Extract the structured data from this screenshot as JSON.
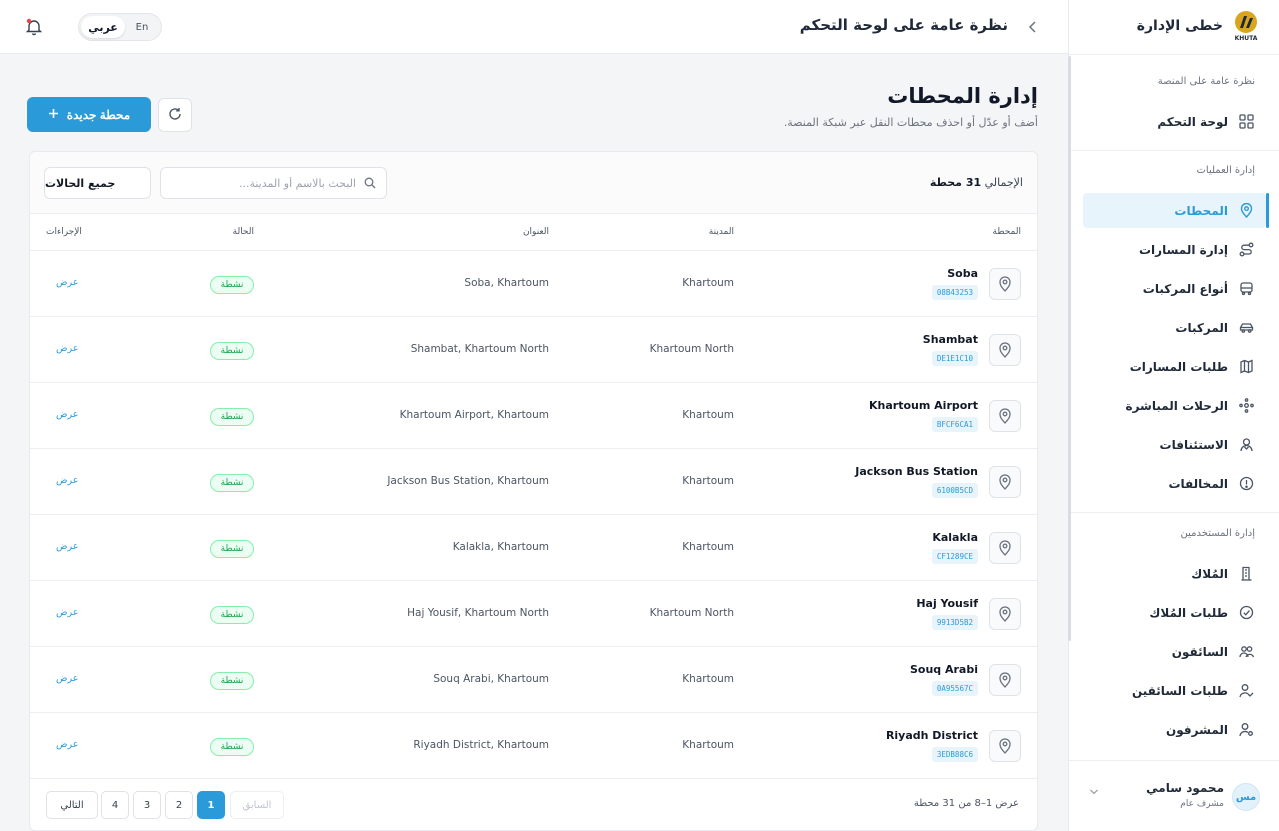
{
  "topbar": {
    "title": "نظرة عامة على لوحة التحكم",
    "lang_active": "عربي",
    "lang_other": "En"
  },
  "brand": {
    "name": "خطى الإدارة",
    "logo_text": "KHUTA"
  },
  "sidebar": {
    "sections": [
      {
        "title": "نظرة عامة على المنصة"
      },
      {
        "title": "إدارة العمليات"
      },
      {
        "title": "إدارة المستخدمين"
      }
    ],
    "items": [
      {
        "label": "لوحة التحكم",
        "icon": "grid-icon",
        "active": false
      },
      {
        "label": "المحطات",
        "icon": "location-pin-icon",
        "active": true
      },
      {
        "label": "إدارة المسارات",
        "icon": "route-icon",
        "active": false
      },
      {
        "label": "أنواع المركبات",
        "icon": "bus-icon",
        "active": false
      },
      {
        "label": "المركبات",
        "icon": "car-icon",
        "active": false
      },
      {
        "label": "طلبات المسارات",
        "icon": "map-request-icon",
        "active": false
      },
      {
        "label": "الرحلات المباشرة",
        "icon": "live-trip-icon",
        "active": false
      },
      {
        "label": "الاستئنافات",
        "icon": "appeal-icon",
        "active": false
      },
      {
        "label": "المخالفات",
        "icon": "alert-circle-icon",
        "active": false
      },
      {
        "label": "المُلاك",
        "icon": "building-icon",
        "active": false
      },
      {
        "label": "طلبات المُلاك",
        "icon": "check-circle-icon",
        "active": false
      },
      {
        "label": "السائقون",
        "icon": "users-icon",
        "active": false
      },
      {
        "label": "طلبات السائقين",
        "icon": "user-check-icon",
        "active": false
      },
      {
        "label": "المشرفون",
        "icon": "user-gear-icon",
        "active": false
      }
    ],
    "user": {
      "initials": "مس",
      "name": "محمود سامي",
      "role": "مشرف عام"
    }
  },
  "main": {
    "title": "إدارة المحطات",
    "subtitle": "أضف أو عدّل أو احذف محطات النقل عبر شبكة المنصة.",
    "new_button": "محطة جديدة",
    "total_prefix": "الإجمالي",
    "total_value": "31 محطة",
    "search_placeholder": "البحث بالاسم أو المدينة...",
    "status_filter": "جميع الحالات",
    "columns": {
      "station": "المحطة",
      "city": "المدينة",
      "address": "العنوان",
      "status": "الحالة",
      "actions": "الإجراءات"
    },
    "rows": [
      {
        "name": "Soba",
        "code": "08B43253",
        "city": "Khartoum",
        "address": "Soba, Khartoum",
        "status": "نشطة",
        "action": "عرض"
      },
      {
        "name": "Shambat",
        "code": "DE1E1C10",
        "city": "Khartoum North",
        "address": "Shambat, Khartoum North",
        "status": "نشطة",
        "action": "عرض"
      },
      {
        "name": "Khartoum Airport",
        "code": "BFCF6CA1",
        "city": "Khartoum",
        "address": "Khartoum Airport, Khartoum",
        "status": "نشطة",
        "action": "عرض"
      },
      {
        "name": "Jackson Bus Station",
        "code": "6100B5CD",
        "city": "Khartoum",
        "address": "Jackson Bus Station, Khartoum",
        "status": "نشطة",
        "action": "عرض"
      },
      {
        "name": "Kalakla",
        "code": "CF1289CE",
        "city": "Khartoum",
        "address": "Kalakla, Khartoum",
        "status": "نشطة",
        "action": "عرض"
      },
      {
        "name": "Haj Yousif",
        "code": "9913D5B2",
        "city": "Khartoum North",
        "address": "Haj Yousif, Khartoum North",
        "status": "نشطة",
        "action": "عرض"
      },
      {
        "name": "Souq Arabi",
        "code": "0A95567C",
        "city": "Khartoum",
        "address": "Souq Arabi, Khartoum",
        "status": "نشطة",
        "action": "عرض"
      },
      {
        "name": "Riyadh District",
        "code": "3EDB88C6",
        "city": "Khartoum",
        "address": "Riyadh District, Khartoum",
        "status": "نشطة",
        "action": "عرض"
      }
    ],
    "pagination": {
      "info": "عرض 1–8 من 31 محطة",
      "prev": "السابق",
      "next": "التالي",
      "pages": [
        "1",
        "2",
        "3",
        "4"
      ],
      "current": "1"
    }
  },
  "colors": {
    "accent": "#2a9bd8",
    "success": "#16a34a",
    "brand_gold": "#d9a521"
  }
}
